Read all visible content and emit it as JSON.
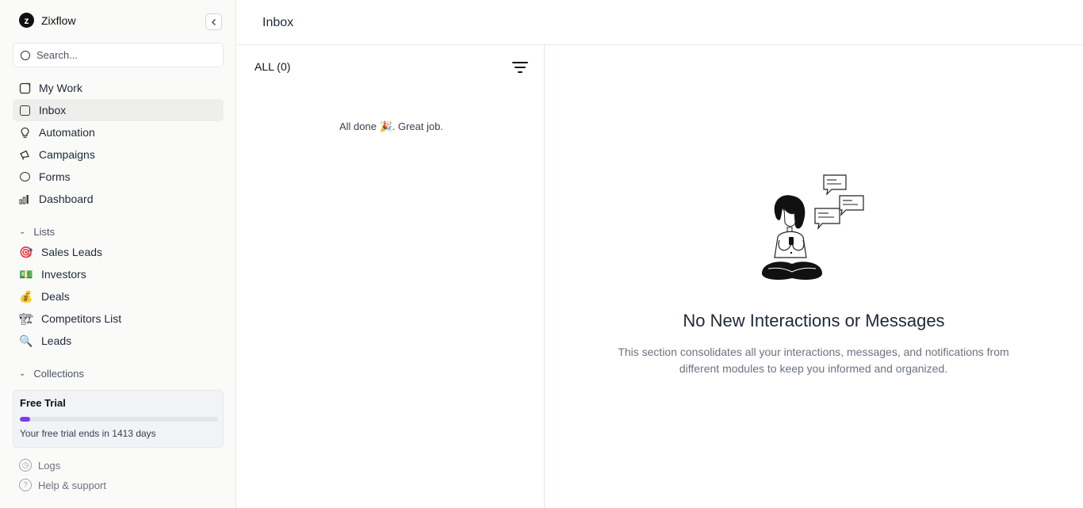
{
  "brand": {
    "logo_letter": "z",
    "name": "Zixflow"
  },
  "search": {
    "placeholder": "Search..."
  },
  "nav": {
    "items": [
      {
        "label": "My Work"
      },
      {
        "label": "Inbox"
      },
      {
        "label": "Automation"
      },
      {
        "label": "Campaigns"
      },
      {
        "label": "Forms"
      },
      {
        "label": "Dashboard"
      }
    ],
    "active": "Inbox"
  },
  "lists": {
    "title": "Lists",
    "items": [
      {
        "label": "Sales Leads",
        "emoji": "🎯"
      },
      {
        "label": "Investors",
        "emoji": "💵"
      },
      {
        "label": "Deals",
        "emoji": "💰"
      },
      {
        "label": "Competitors List",
        "emoji": "🏗"
      },
      {
        "label": "Leads",
        "emoji": "🔍"
      }
    ]
  },
  "collections": {
    "title": "Collections"
  },
  "trial": {
    "title": "Free Trial",
    "text": "Your free trial ends in 1413 days",
    "progress_percent": 5,
    "accent": "#7c3aed"
  },
  "footer": {
    "logs": "Logs",
    "help": "Help & support"
  },
  "header": {
    "title": "Inbox"
  },
  "inbox_list": {
    "filter_label": "ALL (0)",
    "empty_text": "All done 🎉. Great job."
  },
  "detail": {
    "empty_title": "No New Interactions or Messages",
    "empty_desc": "This section consolidates all your interactions, messages, and notifications from different modules to keep you informed and organized."
  }
}
